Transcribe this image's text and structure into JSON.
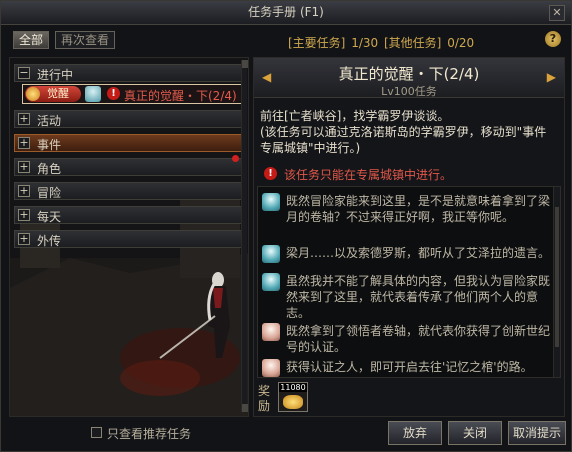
{
  "window": {
    "title": "任务手册 (F1)"
  },
  "tabs": {
    "all": "全部",
    "review": "再次查看"
  },
  "stats": {
    "main_label": "[主要任务]",
    "main_value": "1/30",
    "other_label": "[其他任务]",
    "other_value": "0/20"
  },
  "help": "?",
  "categories": [
    {
      "label": "进行中",
      "toggle": "−"
    },
    {
      "label": "活动",
      "toggle": "+"
    },
    {
      "label": "事件",
      "toggle": "+"
    },
    {
      "label": "角色",
      "toggle": "+"
    },
    {
      "label": "冒险",
      "toggle": "+"
    },
    {
      "label": "每天",
      "toggle": "+"
    },
    {
      "label": "外传",
      "toggle": "+"
    }
  ],
  "quest_entry": {
    "tag": "觉醒",
    "title": "真正的觉醒・下(2/4)"
  },
  "detail": {
    "arrow_left": "◀",
    "arrow_right": "▶",
    "title": "真正的觉醒・下(2/4)",
    "level": "Lv100任务",
    "desc_line1": "前往[亡者峡谷]，找学霸罗伊谈谈。",
    "desc_line2": "(该任务可以通过克洛诺斯岛的学霸罗伊，移动到\"事件专属城镇\"中进行。)",
    "restriction": "该任务只能在专属城镇中进行。"
  },
  "dialogue": [
    {
      "speaker": "teal",
      "text": "既然冒险家能来到这里，是不是就意味着拿到了梁月的卷轴？不过来得正好啊，我正等你呢。"
    },
    {
      "speaker": "teal",
      "text": "梁月……以及索德罗斯，都听从了艾泽拉的遗言。"
    },
    {
      "speaker": "teal",
      "text": "虽然我并不能了解具体的内容，但我认为冒险家既然来到了这里，就代表着传承了他们两个人的意志。"
    },
    {
      "speaker": "pale",
      "text": "既然拿到了领悟者卷轴，就代表你获得了创新世纪号的认证。"
    },
    {
      "speaker": "pale",
      "text": "获得认证之人，即可开启去往'记忆之棺'的路。"
    }
  ],
  "reward": {
    "label": "奖励",
    "count": "11080"
  },
  "footer": {
    "filter_label": "只查看推荐任务",
    "abandon": "放弃",
    "close": "关闭",
    "cancel_hint": "取消提示"
  },
  "colors": {
    "quest_red": "#e45a4c",
    "gold_accent": "#cfa84f",
    "active_category": "#6e3a1c"
  }
}
